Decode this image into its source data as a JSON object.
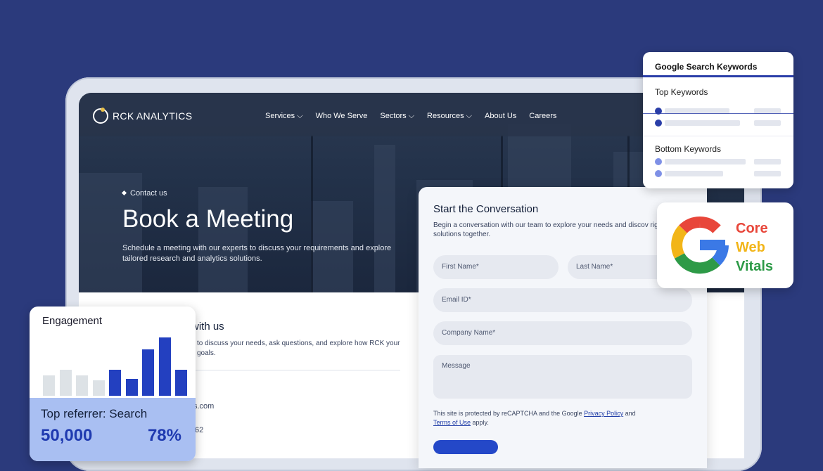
{
  "brand": {
    "name": "RCK ANALYTICS"
  },
  "nav": {
    "items": [
      {
        "label": "Services ⌵"
      },
      {
        "label": "Who We Serve"
      },
      {
        "label": "Sectors ⌵"
      },
      {
        "label": "Resources ⌵"
      },
      {
        "label": "About Us"
      },
      {
        "label": "Careers"
      }
    ]
  },
  "hero": {
    "breadcrumb": "Contact us",
    "title": "Book a Meeting",
    "subtitle": "Schedule a meeting with our experts to discuss your requirements and explore tailored research and analytics solutions."
  },
  "contact": {
    "title_partial": "with us",
    "text_partial": "to discuss your needs, ask questions, and explore how RCK your goals.",
    "email_partial": "ics.com",
    "phone_partial": "62"
  },
  "form": {
    "title": "Start the Conversation",
    "description": "Begin a conversation with our team to explore your needs and discov right solutions together.",
    "first_name": "First Name*",
    "last_name": "Last Name*",
    "email": "Email ID*",
    "company": "Company Name*",
    "message": "Message",
    "recaptcha_prefix": "This site is protected by reCAPTCHA and the Google ",
    "privacy_link": "Privacy Policy",
    "recaptcha_and": " and",
    "terms_link": "Terms of Use",
    "recaptcha_suffix": " apply."
  },
  "keywords_card": {
    "title": "Google Search Keywords",
    "top_label": "Top Keywords",
    "bottom_label": "Bottom Keywords",
    "colors": {
      "accent": "#2a3ea8",
      "top_dot": "#2a3ea8",
      "bottom_dot": "#7e90e6"
    }
  },
  "cwv_card": {
    "icon": "google-g-icon",
    "line1": "Core",
    "line2": "Web",
    "line3": "Vitals",
    "colors": {
      "core": "#e8463a",
      "web": "#f2b518",
      "vitals": "#2d9a47"
    }
  },
  "engagement_card": {
    "title": "Engagement",
    "bars": [
      {
        "value": 0.34,
        "highlight": false
      },
      {
        "value": 0.44,
        "highlight": false
      },
      {
        "value": 0.34,
        "highlight": false
      },
      {
        "value": 0.26,
        "highlight": false
      },
      {
        "value": 0.44,
        "highlight": true
      },
      {
        "value": 0.28,
        "highlight": true
      },
      {
        "value": 0.78,
        "highlight": true
      },
      {
        "value": 0.98,
        "highlight": true
      },
      {
        "value": 0.44,
        "highlight": true
      }
    ],
    "colors": {
      "muted": "#dde2e6",
      "highlight": "#2340c0"
    },
    "referrer_label": "Top referrer: Search",
    "referrer_value": "50,000",
    "referrer_pct": "78%"
  }
}
